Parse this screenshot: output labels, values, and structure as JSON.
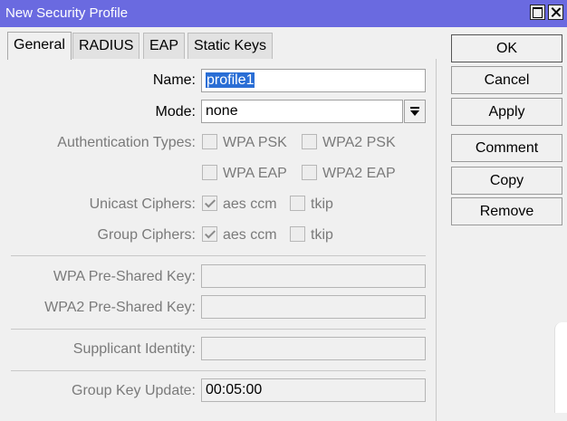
{
  "window": {
    "title": "New Security Profile"
  },
  "tabs": [
    {
      "label": "General"
    },
    {
      "label": "RADIUS"
    },
    {
      "label": "EAP"
    },
    {
      "label": "Static Keys"
    }
  ],
  "form": {
    "name": {
      "label": "Name:",
      "value": "profile1"
    },
    "mode": {
      "label": "Mode:",
      "value": "none"
    },
    "auth_types": {
      "label": "Authentication Types:",
      "options": [
        {
          "label": "WPA PSK",
          "checked": false
        },
        {
          "label": "WPA2 PSK",
          "checked": false
        },
        {
          "label": "WPA EAP",
          "checked": false
        },
        {
          "label": "WPA2 EAP",
          "checked": false
        }
      ]
    },
    "unicast_ciphers": {
      "label": "Unicast Ciphers:",
      "options": [
        {
          "label": "aes ccm",
          "checked": true
        },
        {
          "label": "tkip",
          "checked": false
        }
      ]
    },
    "group_ciphers": {
      "label": "Group Ciphers:",
      "options": [
        {
          "label": "aes ccm",
          "checked": true
        },
        {
          "label": "tkip",
          "checked": false
        }
      ]
    },
    "wpa_psk": {
      "label": "WPA Pre-Shared Key:",
      "value": ""
    },
    "wpa2_psk": {
      "label": "WPA2 Pre-Shared Key:",
      "value": ""
    },
    "supplicant_identity": {
      "label": "Supplicant Identity:",
      "value": ""
    },
    "group_key_update": {
      "label": "Group Key Update:",
      "value": "00:05:00"
    }
  },
  "buttons": {
    "ok": "OK",
    "cancel": "Cancel",
    "apply": "Apply",
    "comment": "Comment",
    "copy": "Copy",
    "remove": "Remove"
  },
  "colors": {
    "titlebar": "#6a6ae0",
    "selection": "#2a6ed5"
  }
}
